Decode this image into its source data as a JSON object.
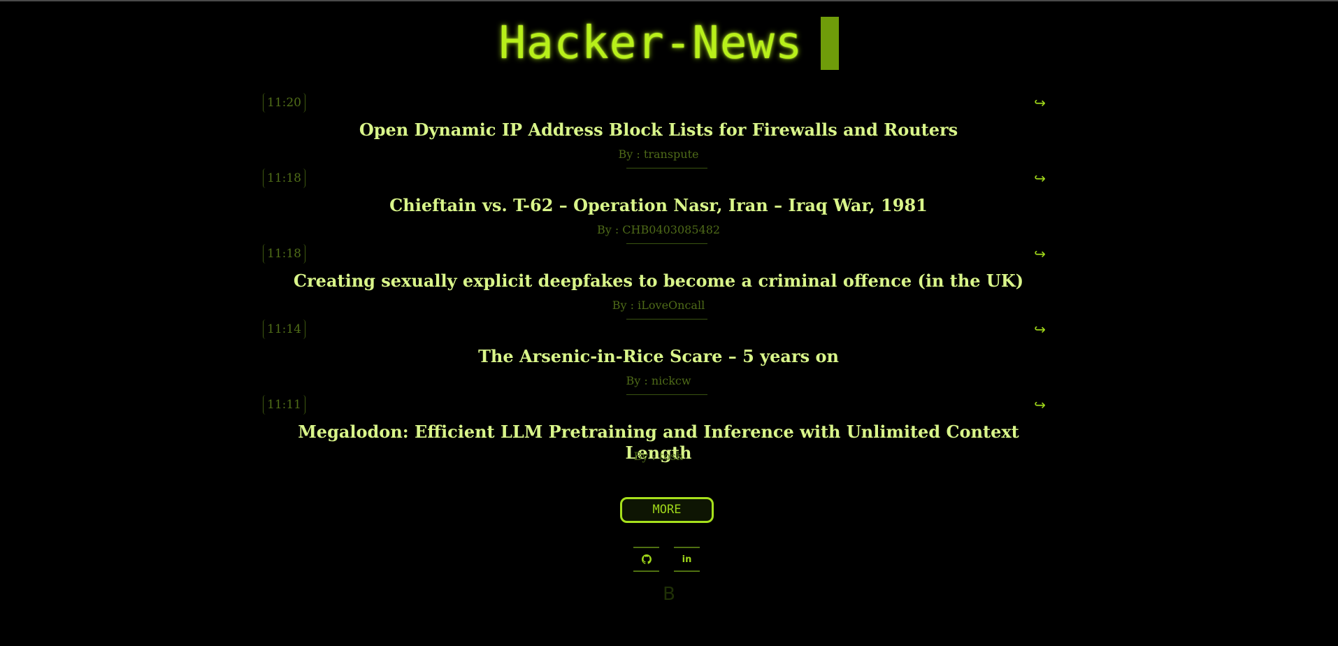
{
  "header": {
    "title": "Hacker-News"
  },
  "stories": [
    {
      "time": "11:20",
      "title": "Open Dynamic IP Address Block Lists for Firewalls and Routers",
      "byline": "By : transpute",
      "link_glyph": "↪"
    },
    {
      "time": "11:18",
      "title": "Chieftain vs. T-62 – Operation Nasr, Iran – Iraq War, 1981",
      "byline": "By : CHB0403085482",
      "link_glyph": "↪"
    },
    {
      "time": "11:18",
      "title": "Creating sexually explicit deepfakes to become a criminal offence (in the UK)",
      "byline": "By : iLoveOncall",
      "link_glyph": "↪"
    },
    {
      "time": "11:14",
      "title": "The Arsenic-in-Rice Scare – 5 years on",
      "byline": "By : nickcw",
      "link_glyph": "↪"
    },
    {
      "time": "11:11",
      "title": "Megalodon: Efficient LLM Pretraining and Inference with Unlimited Context Length",
      "byline": "By : tosh",
      "link_glyph": "↪"
    }
  ],
  "more_button": {
    "label": "MORE"
  },
  "social": {
    "github_icon": "github-icon",
    "linkedin_label": "in"
  },
  "footer": {
    "brand_letter": "B"
  },
  "colors": {
    "background": "#000000",
    "accent": "#b8f01a",
    "headline": "#d9f58a",
    "muted": "#506d18"
  }
}
